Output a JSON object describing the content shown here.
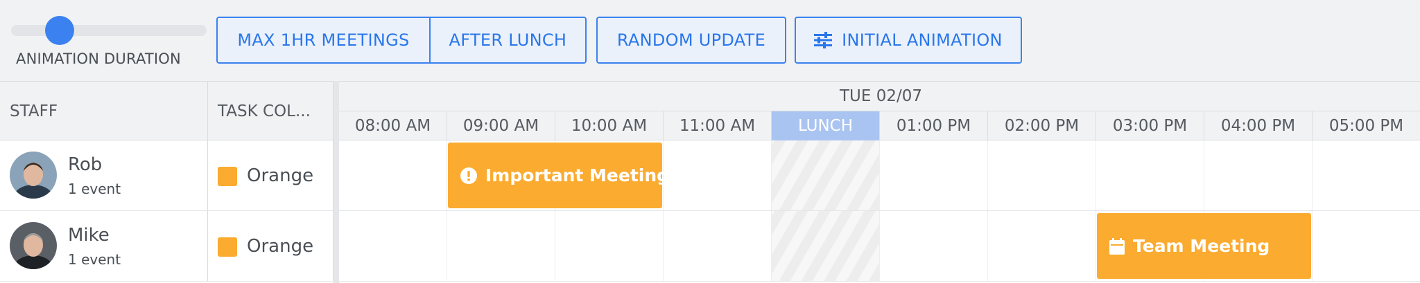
{
  "toolbar": {
    "slider": {
      "label": "ANIMATION DURATION",
      "value_fraction": 0.18
    },
    "buttons": {
      "max_meetings": "MAX 1HR MEETINGS",
      "after_lunch": "AFTER LUNCH",
      "random_update": "RANDOM UPDATE",
      "initial_animation": "INITIAL ANIMATION"
    }
  },
  "grid": {
    "columns": {
      "staff": "STAFF",
      "task_color": "TASK COL..."
    },
    "day": "TUE 02/07",
    "hours": [
      "08:00 AM",
      "09:00 AM",
      "10:00 AM",
      "11:00 AM",
      "LUNCH",
      "01:00 PM",
      "02:00 PM",
      "03:00 PM",
      "04:00 PM",
      "05:00 PM"
    ],
    "rows": [
      {
        "name": "Rob",
        "events_count": "1 event",
        "color_name": "Orange",
        "event": {
          "title": "Important Meeting",
          "icon": "exclamation-circle-icon",
          "start_hour_index": 1,
          "span_hours": 2
        }
      },
      {
        "name": "Mike",
        "events_count": "1 event",
        "color_name": "Orange",
        "event": {
          "title": "Team Meeting",
          "icon": "calendar-icon",
          "start_hour_index": 7,
          "span_hours": 2
        }
      }
    ]
  },
  "colors": {
    "accent": "#3b82f0",
    "event_orange": "#fbab2f",
    "lunch_header": "#a9c4f1"
  }
}
